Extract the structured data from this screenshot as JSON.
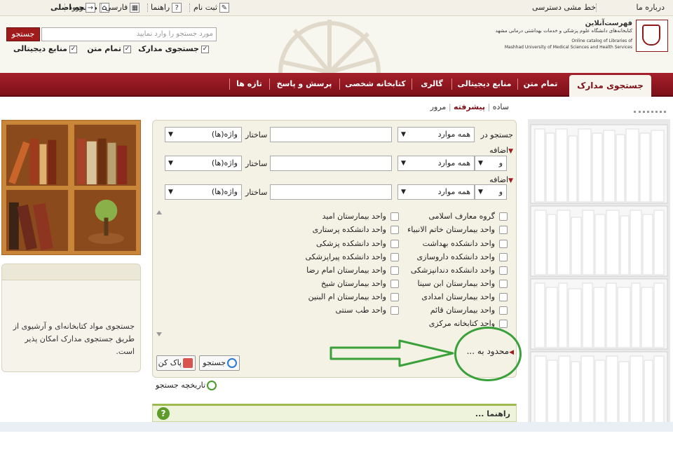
{
  "topbar": {
    "home": "صفحه اصلی",
    "login": "ورود",
    "persian": "فارسی",
    "help": "راهنما",
    "register": "ثبت نام",
    "about": "درباره ما",
    "access_policy": "خط مشی دسترسی"
  },
  "header": {
    "logo_title": "فهرست‌آنلاین",
    "logo_fa": "کتابخانه‌های دانشگاه علوم پزشکی و خدمات بهداشتی درمانی مشهد",
    "logo_en1": "Online catalog of Libraries of",
    "logo_en2": "Mashhad University of Medical Sciences and Health Services",
    "search_button": "جستجو",
    "search_placeholder": "مورد جستجو را وارد نمایید",
    "check_docs": "جستجوی مدارک",
    "check_fulltext": "تمام متن",
    "check_digital": "منابع دیجیتالی"
  },
  "nav": {
    "tabs": [
      "جستجوی مدارک",
      "تمام متن",
      "منابع دیجیتالی",
      "گالری",
      "کتابخانه شخصی",
      "پرسش و پاسخ",
      "تازه ها"
    ]
  },
  "subnav": {
    "simple": "ساده",
    "advanced": "پیشرفته",
    "browse": "مرور"
  },
  "form": {
    "search_in": "جستجو در",
    "add": "اضافه",
    "all_items": "همه موارد",
    "structure": "ساختار",
    "words": "واژه(ها)",
    "and": "و"
  },
  "units": {
    "right_col": [
      "گروه معارف اسلامی",
      "واحد بیمارستان خاتم الانبیاء",
      "واحد دانشکده بهداشت",
      "واحد دانشکده داروسازی",
      "واحد دانشکده دندانپزشکی",
      "واحد بیمارستان ابن سینا",
      "واحد بیمارستان امدادی",
      "واحد بیمارستان قائم",
      "واحد کتابخانه مرکزی"
    ],
    "left_col": [
      "واحد بیمارستان امید",
      "واحد دانشکده پرستاری",
      "واحد دانشکده پزشکی",
      "واحد دانشکده پیراپزشکی",
      "واحد بیمارستان امام رضا",
      "واحد بیمارستان شیخ",
      "واحد بیمارستان ام البنین",
      "واحد طب سنتی"
    ]
  },
  "limit_to": "محدود به ...",
  "buttons": {
    "search": "جستجو",
    "clear": "پاک کن"
  },
  "history": "تاریخچه جستجو",
  "help_title": "راهنما ...",
  "side_text": "جستجوی مواد کتابخانه‌ای و آرشیوی از طریق جستجوی مدارک امکان پذیر است.",
  "colors": {
    "brand_red": "#a01c1c",
    "annotation_green": "#3aa03a"
  }
}
